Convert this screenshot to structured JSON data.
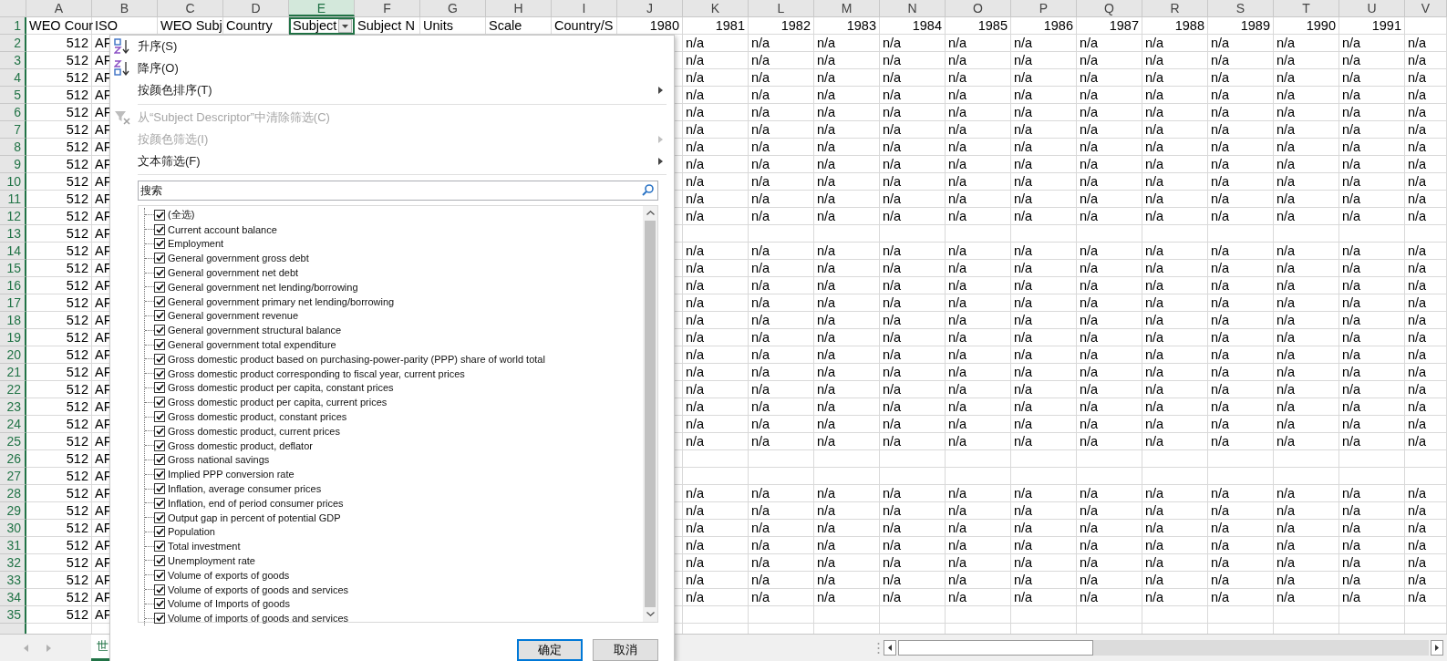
{
  "columns": [
    {
      "letter": "A",
      "selected": false
    },
    {
      "letter": "B",
      "selected": false
    },
    {
      "letter": "C",
      "selected": false
    },
    {
      "letter": "D",
      "selected": false
    },
    {
      "letter": "E",
      "selected": true
    },
    {
      "letter": "F",
      "selected": false
    },
    {
      "letter": "G",
      "selected": false
    },
    {
      "letter": "H",
      "selected": false
    },
    {
      "letter": "I",
      "selected": false
    },
    {
      "letter": "J",
      "selected": false
    },
    {
      "letter": "K",
      "selected": false
    },
    {
      "letter": "L",
      "selected": false
    },
    {
      "letter": "M",
      "selected": false
    },
    {
      "letter": "N",
      "selected": false
    },
    {
      "letter": "O",
      "selected": false
    },
    {
      "letter": "P",
      "selected": false
    },
    {
      "letter": "Q",
      "selected": false
    },
    {
      "letter": "R",
      "selected": false
    },
    {
      "letter": "S",
      "selected": false
    },
    {
      "letter": "T",
      "selected": false
    },
    {
      "letter": "U",
      "selected": false
    },
    {
      "letter": "V",
      "selected": false
    }
  ],
  "header_row": {
    "number": "1",
    "cells": [
      {
        "text": "WEO Cour",
        "kind": "text",
        "active": false
      },
      {
        "text": "ISO",
        "kind": "text",
        "active": false
      },
      {
        "text": "WEO Subj",
        "kind": "text",
        "active": false
      },
      {
        "text": "Country",
        "kind": "text",
        "active": false
      },
      {
        "text": "Subject",
        "kind": "text",
        "active": true
      },
      {
        "text": "Subject N",
        "kind": "text",
        "active": false
      },
      {
        "text": "Units",
        "kind": "text",
        "active": false
      },
      {
        "text": "Scale",
        "kind": "text",
        "active": false
      },
      {
        "text": "Country/S",
        "kind": "text",
        "active": false
      },
      {
        "text": "1980",
        "kind": "number",
        "active": false
      },
      {
        "text": "1981",
        "kind": "number",
        "active": false
      },
      {
        "text": "1982",
        "kind": "number",
        "active": false
      },
      {
        "text": "1983",
        "kind": "number",
        "active": false
      },
      {
        "text": "1984",
        "kind": "number",
        "active": false
      },
      {
        "text": "1985",
        "kind": "number",
        "active": false
      },
      {
        "text": "1986",
        "kind": "number",
        "active": false
      },
      {
        "text": "1987",
        "kind": "number",
        "active": false
      },
      {
        "text": "1988",
        "kind": "number",
        "active": false
      },
      {
        "text": "1989",
        "kind": "number",
        "active": false
      },
      {
        "text": "1990",
        "kind": "number",
        "active": false
      },
      {
        "text": "1991",
        "kind": "number",
        "active": false
      }
    ]
  },
  "rows": [
    {
      "number": "2",
      "a": "512",
      "b": "AF",
      "values": [
        "n/a",
        "n/a",
        "n/a",
        "n/a",
        "n/a",
        "n/a",
        "n/a",
        "n/a",
        "n/a",
        "n/a",
        "n/a",
        "n/a"
      ]
    },
    {
      "number": "3",
      "a": "512",
      "b": "AF",
      "values": [
        "n/a",
        "n/a",
        "n/a",
        "n/a",
        "n/a",
        "n/a",
        "n/a",
        "n/a",
        "n/a",
        "n/a",
        "n/a",
        "n/a"
      ]
    },
    {
      "number": "4",
      "a": "512",
      "b": "AF",
      "values": [
        "n/a",
        "n/a",
        "n/a",
        "n/a",
        "n/a",
        "n/a",
        "n/a",
        "n/a",
        "n/a",
        "n/a",
        "n/a",
        "n/a"
      ]
    },
    {
      "number": "5",
      "a": "512",
      "b": "AF",
      "values": [
        "n/a",
        "n/a",
        "n/a",
        "n/a",
        "n/a",
        "n/a",
        "n/a",
        "n/a",
        "n/a",
        "n/a",
        "n/a",
        "n/a"
      ]
    },
    {
      "number": "6",
      "a": "512",
      "b": "AF",
      "values": [
        "n/a",
        "n/a",
        "n/a",
        "n/a",
        "n/a",
        "n/a",
        "n/a",
        "n/a",
        "n/a",
        "n/a",
        "n/a",
        "n/a"
      ]
    },
    {
      "number": "7",
      "a": "512",
      "b": "AF",
      "values": [
        "n/a",
        "n/a",
        "n/a",
        "n/a",
        "n/a",
        "n/a",
        "n/a",
        "n/a",
        "n/a",
        "n/a",
        "n/a",
        "n/a"
      ]
    },
    {
      "number": "8",
      "a": "512",
      "b": "AF",
      "values": [
        "n/a",
        "n/a",
        "n/a",
        "n/a",
        "n/a",
        "n/a",
        "n/a",
        "n/a",
        "n/a",
        "n/a",
        "n/a",
        "n/a"
      ]
    },
    {
      "number": "9",
      "a": "512",
      "b": "AF",
      "values": [
        "n/a",
        "n/a",
        "n/a",
        "n/a",
        "n/a",
        "n/a",
        "n/a",
        "n/a",
        "n/a",
        "n/a",
        "n/a",
        "n/a"
      ]
    },
    {
      "number": "10",
      "a": "512",
      "b": "AF",
      "values": [
        "n/a",
        "n/a",
        "n/a",
        "n/a",
        "n/a",
        "n/a",
        "n/a",
        "n/a",
        "n/a",
        "n/a",
        "n/a",
        "n/a"
      ]
    },
    {
      "number": "11",
      "a": "512",
      "b": "AF",
      "values": [
        "n/a",
        "n/a",
        "n/a",
        "n/a",
        "n/a",
        "n/a",
        "n/a",
        "n/a",
        "n/a",
        "n/a",
        "n/a",
        "n/a"
      ]
    },
    {
      "number": "12",
      "a": "512",
      "b": "AF",
      "values": [
        "n/a",
        "n/a",
        "n/a",
        "n/a",
        "n/a",
        "n/a",
        "n/a",
        "n/a",
        "n/a",
        "n/a",
        "n/a",
        "n/a"
      ]
    },
    {
      "number": "13",
      "a": "512",
      "b": "AF"
    },
    {
      "number": "14",
      "a": "512",
      "b": "AF",
      "values": [
        "n/a",
        "n/a",
        "n/a",
        "n/a",
        "n/a",
        "n/a",
        "n/a",
        "n/a",
        "n/a",
        "n/a",
        "n/a",
        "n/a"
      ]
    },
    {
      "number": "15",
      "a": "512",
      "b": "AF",
      "values": [
        "n/a",
        "n/a",
        "n/a",
        "n/a",
        "n/a",
        "n/a",
        "n/a",
        "n/a",
        "n/a",
        "n/a",
        "n/a",
        "n/a"
      ]
    },
    {
      "number": "16",
      "a": "512",
      "b": "AF",
      "values": [
        "n/a",
        "n/a",
        "n/a",
        "n/a",
        "n/a",
        "n/a",
        "n/a",
        "n/a",
        "n/a",
        "n/a",
        "n/a",
        "n/a"
      ]
    },
    {
      "number": "17",
      "a": "512",
      "b": "AF",
      "values": [
        "n/a",
        "n/a",
        "n/a",
        "n/a",
        "n/a",
        "n/a",
        "n/a",
        "n/a",
        "n/a",
        "n/a",
        "n/a",
        "n/a"
      ]
    },
    {
      "number": "18",
      "a": "512",
      "b": "AF",
      "values": [
        "n/a",
        "n/a",
        "n/a",
        "n/a",
        "n/a",
        "n/a",
        "n/a",
        "n/a",
        "n/a",
        "n/a",
        "n/a",
        "n/a"
      ]
    },
    {
      "number": "19",
      "a": "512",
      "b": "AF",
      "values": [
        "n/a",
        "n/a",
        "n/a",
        "n/a",
        "n/a",
        "n/a",
        "n/a",
        "n/a",
        "n/a",
        "n/a",
        "n/a",
        "n/a"
      ]
    },
    {
      "number": "20",
      "a": "512",
      "b": "AF",
      "values": [
        "n/a",
        "n/a",
        "n/a",
        "n/a",
        "n/a",
        "n/a",
        "n/a",
        "n/a",
        "n/a",
        "n/a",
        "n/a",
        "n/a"
      ]
    },
    {
      "number": "21",
      "a": "512",
      "b": "AF",
      "values": [
        "n/a",
        "n/a",
        "n/a",
        "n/a",
        "n/a",
        "n/a",
        "n/a",
        "n/a",
        "n/a",
        "n/a",
        "n/a",
        "n/a"
      ]
    },
    {
      "number": "22",
      "a": "512",
      "b": "AF",
      "values": [
        "n/a",
        "n/a",
        "n/a",
        "n/a",
        "n/a",
        "n/a",
        "n/a",
        "n/a",
        "n/a",
        "n/a",
        "n/a",
        "n/a"
      ]
    },
    {
      "number": "23",
      "a": "512",
      "b": "AF",
      "values": [
        "n/a",
        "n/a",
        "n/a",
        "n/a",
        "n/a",
        "n/a",
        "n/a",
        "n/a",
        "n/a",
        "n/a",
        "n/a",
        "n/a"
      ]
    },
    {
      "number": "24",
      "a": "512",
      "b": "AF",
      "values": [
        "n/a",
        "n/a",
        "n/a",
        "n/a",
        "n/a",
        "n/a",
        "n/a",
        "n/a",
        "n/a",
        "n/a",
        "n/a",
        "n/a"
      ]
    },
    {
      "number": "25",
      "a": "512",
      "b": "AF",
      "values": [
        "n/a",
        "n/a",
        "n/a",
        "n/a",
        "n/a",
        "n/a",
        "n/a",
        "n/a",
        "n/a",
        "n/a",
        "n/a",
        "n/a"
      ]
    },
    {
      "number": "26",
      "a": "512",
      "b": "AF"
    },
    {
      "number": "27",
      "a": "512",
      "b": "AF"
    },
    {
      "number": "28",
      "a": "512",
      "b": "AF",
      "values": [
        "n/a",
        "n/a",
        "n/a",
        "n/a",
        "n/a",
        "n/a",
        "n/a",
        "n/a",
        "n/a",
        "n/a",
        "n/a",
        "n/a"
      ]
    },
    {
      "number": "29",
      "a": "512",
      "b": "AF",
      "values": [
        "n/a",
        "n/a",
        "n/a",
        "n/a",
        "n/a",
        "n/a",
        "n/a",
        "n/a",
        "n/a",
        "n/a",
        "n/a",
        "n/a"
      ]
    },
    {
      "number": "30",
      "a": "512",
      "b": "AF",
      "values": [
        "n/a",
        "n/a",
        "n/a",
        "n/a",
        "n/a",
        "n/a",
        "n/a",
        "n/a",
        "n/a",
        "n/a",
        "n/a",
        "n/a"
      ]
    },
    {
      "number": "31",
      "a": "512",
      "b": "AF",
      "values": [
        "n/a",
        "n/a",
        "n/a",
        "n/a",
        "n/a",
        "n/a",
        "n/a",
        "n/a",
        "n/a",
        "n/a",
        "n/a",
        "n/a"
      ]
    },
    {
      "number": "32",
      "a": "512",
      "b": "AF",
      "values": [
        "n/a",
        "n/a",
        "n/a",
        "n/a",
        "n/a",
        "n/a",
        "n/a",
        "n/a",
        "n/a",
        "n/a",
        "n/a",
        "n/a"
      ]
    },
    {
      "number": "33",
      "a": "512",
      "b": "AF",
      "values": [
        "n/a",
        "n/a",
        "n/a",
        "n/a",
        "n/a",
        "n/a",
        "n/a",
        "n/a",
        "n/a",
        "n/a",
        "n/a",
        "n/a"
      ]
    },
    {
      "number": "34",
      "a": "512",
      "b": "AF",
      "values": [
        "n/a",
        "n/a",
        "n/a",
        "n/a",
        "n/a",
        "n/a",
        "n/a",
        "n/a",
        "n/a",
        "n/a",
        "n/a",
        "n/a"
      ]
    },
    {
      "number": "35",
      "a": "512",
      "b": "AF"
    }
  ],
  "sheet_tabs": [
    {
      "label": "世",
      "selected": true
    }
  ],
  "filter_menu": {
    "items": [
      {
        "kind": "sort_asc",
        "label": "升序(S)",
        "disabled": false,
        "submenu": false
      },
      {
        "kind": "sort_desc",
        "label": "降序(O)",
        "disabled": false,
        "submenu": false
      },
      {
        "kind": "plain",
        "label": "按颜色排序(T)",
        "disabled": false,
        "submenu": true
      },
      {
        "kind": "separator"
      },
      {
        "kind": "clear_filter",
        "label": "从“Subject Descriptor”中清除筛选(C)",
        "disabled": true,
        "submenu": false
      },
      {
        "kind": "plain",
        "label": "按颜色筛选(I)",
        "disabled": true,
        "submenu": true
      },
      {
        "kind": "plain",
        "label": "文本筛选(F)",
        "disabled": false,
        "submenu": true
      },
      {
        "kind": "separator"
      }
    ],
    "search": {
      "placeholder": "搜索"
    },
    "checklist": [
      {
        "label": "(全选)",
        "checked": true
      },
      {
        "label": "Current account balance",
        "checked": true
      },
      {
        "label": "Employment",
        "checked": true
      },
      {
        "label": "General government gross debt",
        "checked": true
      },
      {
        "label": "General government net debt",
        "checked": true
      },
      {
        "label": "General government net lending/borrowing",
        "checked": true
      },
      {
        "label": "General government primary net lending/borrowing",
        "checked": true
      },
      {
        "label": "General government revenue",
        "checked": true
      },
      {
        "label": "General government structural balance",
        "checked": true
      },
      {
        "label": "General government total expenditure",
        "checked": true
      },
      {
        "label": "Gross domestic product based on purchasing-power-parity (PPP) share of world total",
        "checked": true
      },
      {
        "label": "Gross domestic product corresponding to fiscal year, current prices",
        "checked": true
      },
      {
        "label": "Gross domestic product per capita, constant prices",
        "checked": true
      },
      {
        "label": "Gross domestic product per capita, current prices",
        "checked": true
      },
      {
        "label": "Gross domestic product, constant prices",
        "checked": true
      },
      {
        "label": "Gross domestic product, current prices",
        "checked": true
      },
      {
        "label": "Gross domestic product, deflator",
        "checked": true
      },
      {
        "label": "Gross national savings",
        "checked": true
      },
      {
        "label": "Implied PPP conversion rate",
        "checked": true
      },
      {
        "label": "Inflation, average consumer prices",
        "checked": true
      },
      {
        "label": "Inflation, end of period consumer prices",
        "checked": true
      },
      {
        "label": "Output gap in percent of potential GDP",
        "checked": true
      },
      {
        "label": "Population",
        "checked": true
      },
      {
        "label": "Total investment",
        "checked": true
      },
      {
        "label": "Unemployment rate",
        "checked": true
      },
      {
        "label": "Volume of exports of goods",
        "checked": true
      },
      {
        "label": "Volume of exports of goods and services",
        "checked": true
      },
      {
        "label": "Volume of Imports of goods",
        "checked": true
      },
      {
        "label": "Volume of imports of goods and services",
        "checked": true
      }
    ],
    "buttons": [
      {
        "label": "确定",
        "default": true
      },
      {
        "label": "取消",
        "default": false
      }
    ]
  }
}
